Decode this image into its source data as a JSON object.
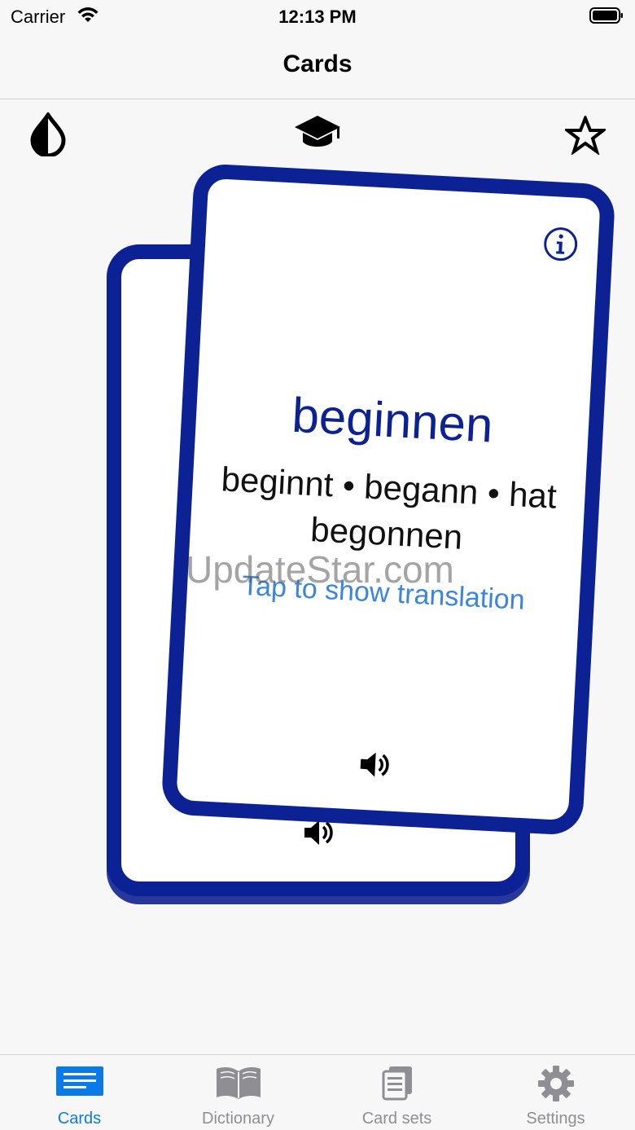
{
  "status_bar": {
    "carrier": "Carrier",
    "time": "12:13 PM"
  },
  "nav": {
    "title": "Cards"
  },
  "toolbar": {
    "icons": [
      "contrast-icon",
      "study-icon",
      "star-icon"
    ]
  },
  "card": {
    "word": "beginnen",
    "forms": "beginnt • begann • hat begonnen",
    "hint": "Tap to show translation"
  },
  "watermark": "UpdateStar.com",
  "tabs": [
    {
      "label": "Cards",
      "icon": "cards-icon",
      "active": true
    },
    {
      "label": "Dictionary",
      "icon": "book-icon",
      "active": false
    },
    {
      "label": "Card sets",
      "icon": "card-sets-icon",
      "active": false
    },
    {
      "label": "Settings",
      "icon": "gear-icon",
      "active": false
    }
  ],
  "colors": {
    "card_border": "#0c2294",
    "accent": "#0a7ae8",
    "hint": "#3a84e2",
    "inactive": "#8e8e93"
  }
}
